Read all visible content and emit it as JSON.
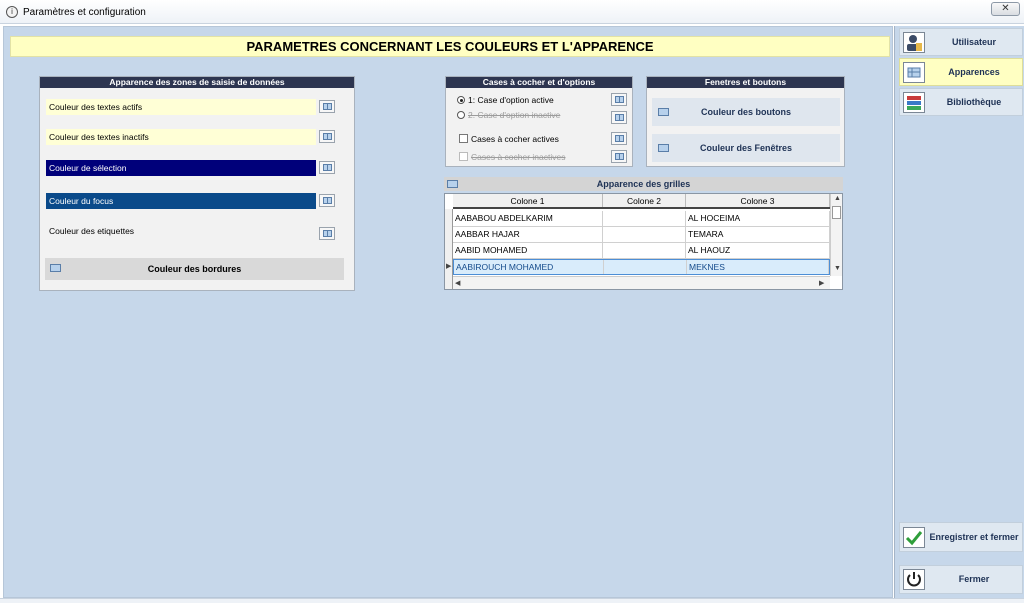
{
  "window": {
    "title": "Paramètres et configuration",
    "close_symbol": "✕"
  },
  "header": {
    "title": "PARAMETRES CONCERNANT LES COULEURS ET L'APPARENCE"
  },
  "zones_panel": {
    "title": "Apparence des zones de  saisie de données",
    "fields": [
      {
        "label": "Couleur des textes actifs",
        "bg": "#ffffd6",
        "fg": "#000000"
      },
      {
        "label": "Couleur des textes inactifs",
        "bg": "#ffffd6",
        "fg": "#000000"
      },
      {
        "label": "Couleur de sélection",
        "bg": "#00007a",
        "fg": "#ffffff"
      },
      {
        "label": "Couleur du focus",
        "bg": "#0a4a8a",
        "fg": "#ffffff"
      },
      {
        "label": "Couleur des etiquettes",
        "bg": "#f2f2f2",
        "fg": "#000000"
      }
    ],
    "border_button": "Couleur des bordures"
  },
  "checkbox_panel": {
    "title": "Cases à cocher et d'options",
    "radio_active": "1: Case d'option active",
    "radio_inactive": "2. Case d'option inactive",
    "check_active": "Cases à cocher actives",
    "check_inactive": "Cases à cocher inactives"
  },
  "windows_panel": {
    "title": "Fenetres et boutons",
    "buttons_color": "Couleur des boutons",
    "windows_color": "Couleur des Fenêtres"
  },
  "grid": {
    "title": "Apparence des grilles",
    "columns": [
      "Colone 1",
      "Colone 2",
      "Colone 3"
    ],
    "rows": [
      [
        "AABABOU ABDELKARIM",
        "",
        "AL HOCEIMA"
      ],
      [
        "AABBAR HAJAR",
        "",
        "TEMARA"
      ],
      [
        "AABID MOHAMED",
        "",
        "AL HAOUZ"
      ],
      [
        "AABIROUCH MOHAMED",
        "",
        "MEKNES"
      ]
    ],
    "selected_row": 3
  },
  "sidebar": {
    "items": [
      {
        "label": "Utilisateur",
        "icon": "user-icon"
      },
      {
        "label": "Apparences",
        "icon": "palette-icon"
      },
      {
        "label": "Bibliothèque",
        "icon": "books-icon"
      }
    ],
    "save_label": "Enregistrer et fermer",
    "close_label": "Fermer"
  },
  "colors": {
    "accent_yellow": "#ffffc2",
    "panel_header": "#2d3550",
    "background": "#c6d7ea"
  }
}
